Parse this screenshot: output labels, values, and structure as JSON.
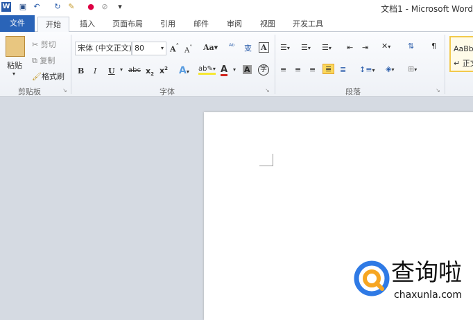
{
  "window": {
    "title": "文档1 - Microsoft Word"
  },
  "quick_access": {
    "icons": [
      "word-logo-icon",
      "save-icon",
      "undo-icon",
      "redo-icon",
      "format-painter-icon",
      "color-icon",
      "eraser-icon",
      "customize-icon"
    ]
  },
  "tabs": [
    {
      "label": "文件"
    },
    {
      "label": "开始",
      "active": true
    },
    {
      "label": "插入"
    },
    {
      "label": "页面布局"
    },
    {
      "label": "引用"
    },
    {
      "label": "邮件"
    },
    {
      "label": "审阅"
    },
    {
      "label": "视图"
    },
    {
      "label": "开发工具"
    }
  ],
  "clipboard": {
    "label": "剪贴板",
    "paste": "粘贴",
    "cut": "剪切",
    "copy": "复制",
    "format_painter": "格式刷"
  },
  "font": {
    "label": "字体",
    "font_name": "宋体 (中文正文)",
    "font_size": "80",
    "font_color": "#d0261f",
    "highlight_color": "#f6e832"
  },
  "paragraph": {
    "label": "段落"
  },
  "styles": {
    "preview": "AaBbCcDc",
    "name": "↵ 正文"
  },
  "watermark": {
    "brand": "查询啦",
    "url": "chaxunla.com",
    "blue": "#2f7ae5",
    "orange": "#f6a623"
  }
}
